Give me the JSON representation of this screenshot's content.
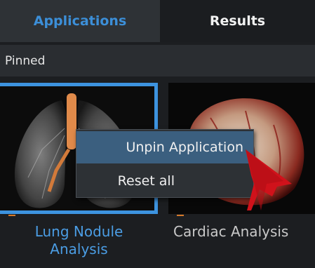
{
  "tabs": [
    {
      "label": "Applications",
      "active": true
    },
    {
      "label": "Results",
      "active": false
    }
  ],
  "section": {
    "title": "Pinned"
  },
  "tiles": [
    {
      "label": "Lung Nodule Analysis",
      "line1": "Lung Nodule",
      "line2": "Analysis",
      "selected": true
    },
    {
      "label": "Cardiac Analysis",
      "selected": false
    }
  ],
  "context_menu": {
    "items": [
      {
        "label": "Unpin Application",
        "highlighted": true
      },
      {
        "label": "Reset all",
        "highlighted": false
      }
    ]
  },
  "colors": {
    "accent": "#3d93df",
    "annotation_arrow": "#d0121b",
    "background": "#1c1e21"
  },
  "icons": {
    "lung_thumbnail": "lung-thumbnail-icon",
    "cardiac_thumbnail": "heart-thumbnail-icon",
    "callout_arrow": "red-arrow-icon"
  }
}
